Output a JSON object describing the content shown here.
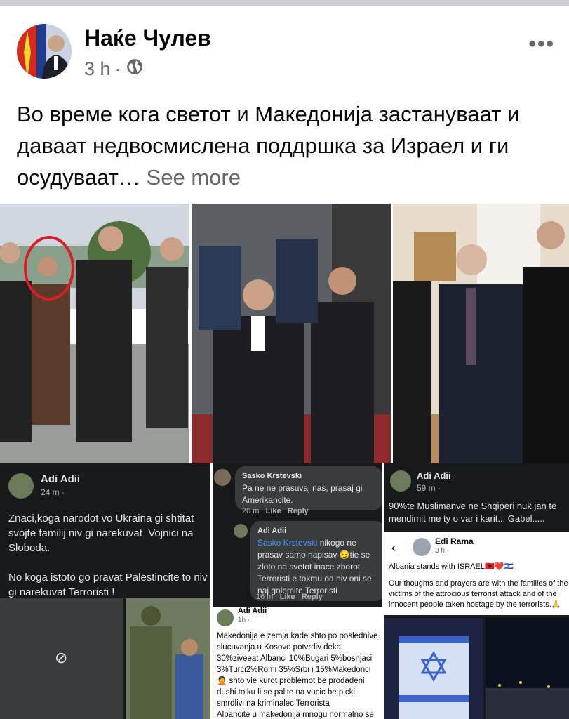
{
  "post": {
    "author": "Наќе Чулев",
    "time": "3 h",
    "text": "Во време кога светот и Македонија застануваат и даваат недвосмислена поддршка за Израел и ги осудуваат…",
    "see_more": "See more"
  },
  "icons": {
    "more": "more-horizontal-icon",
    "audience": "globe-icon"
  },
  "screenshots": {
    "adi1": {
      "name": "Adi Adii",
      "meta": "24 m ·",
      "text": "Znaci,koga narodot vo Ukraina gi shtitat svojte familij niv gi narekuvat  Vojnici na Sloboda.\n\nNo koga istoto go pravat Palestincite to niv gi narekuvat Terroristi !"
    },
    "sasko": {
      "name": "Sasko Krstevski",
      "comment": "Pa ne ne prasuvaj nas, prasaj gi Amerikancite.",
      "time": "20 m",
      "like": "Like",
      "reply": "Reply"
    },
    "adi_reply": {
      "name": "Adi Adii",
      "mention": "Sasko Krstevski",
      "text": " nikogo ne prasav samo napisav 😏tie se zloto na svetot inace zborot Terroristi e tokmu od niv oni se naj golemite Terroristi",
      "time": "16 m",
      "like": "Like",
      "reply": "Reply"
    },
    "adi3": {
      "name": "Adi Adii",
      "meta": "1h ·",
      "text": "Makedonija e zemja kade shto po poslednive slucuvanja u Kosovo potvrdiv deka 30%ziveeat Albanci 10%Bugari 5%bosnjaci 3%Turci2%Romi 35%Srbi i 15%Makedonci 🤦 shto vie kurot problemot be prodadeni dushi tolku li se palite na vucic be picki smrdlivi na kriminalec Terrorista\nAlbancite u makedonija mnogu normalno se grizat za slucuvanjata u kosovo deka se"
    },
    "adi2": {
      "name": "Adi Adii",
      "meta": "59 m ·",
      "text": "90%te Muslimanve ne Shqiperi nuk jan te mendimit me ty o var i karit... Gabel....."
    },
    "rama": {
      "name": "Edi Rama",
      "meta": "3 h ·",
      "line1": "Albania stands with ISRAEL🇦🇱❤️🇮🇱",
      "line2": "Our thoughts and prayers are with the families of the victims of the attrocious terrorist attack and of the innocent people taken hostage by the terrorists.🙏"
    }
  }
}
